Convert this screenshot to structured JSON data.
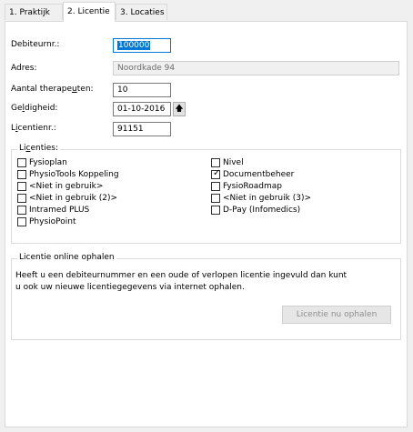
{
  "tabs": [
    {
      "label": "1. Praktijk"
    },
    {
      "label": "2. Licentie"
    },
    {
      "label": "3. Locaties"
    }
  ],
  "form": {
    "debiteurnr": {
      "label": "Debiteurnr.:",
      "value": "100000"
    },
    "adres": {
      "label": "Adres:",
      "value": "Noordkade 94"
    },
    "aantal": {
      "label_pre": "Aantal therape",
      "label_u": "u",
      "label_post": "ten:",
      "value": "10"
    },
    "geldigheid": {
      "label_pre": "Ge",
      "label_u": "l",
      "label_post": "digheid:",
      "value": "01-10-2016",
      "button_glyph": "🡅"
    },
    "licentienr": {
      "label_pre": "L",
      "label_u": "i",
      "label_post": "centienr.:",
      "value": "91151"
    }
  },
  "licenties": {
    "title_pre": "Li",
    "title_u": "c",
    "title_post": "enties:",
    "left": [
      {
        "label": "Fysioplan",
        "checked": false
      },
      {
        "label": "PhysioTools Koppeling",
        "checked": false
      },
      {
        "label": "<Niet in gebruik>",
        "checked": false
      },
      {
        "label": "<Niet in gebruik (2)>",
        "checked": false
      },
      {
        "label": "Intramed PLUS",
        "checked": false
      },
      {
        "label": "PhysioPoint",
        "checked": false
      }
    ],
    "right": [
      {
        "label": "Nivel",
        "checked": false
      },
      {
        "label": "Documentbeheer",
        "checked": true
      },
      {
        "label": "FysioRoadmap",
        "checked": false
      },
      {
        "label": "<Niet in gebruik (3)>",
        "checked": false
      },
      {
        "label": "D-Pay (Infomedics)",
        "checked": false
      }
    ]
  },
  "online": {
    "title": "Licentie online ophalen",
    "text_line1": "Heeft u een debiteurnummer en een oude of verlopen licentie ingevuld dan kunt",
    "text_line2": "u ook uw nieuwe licentiegegevens via internet ophalen.",
    "button": "Licentie nu ophalen"
  }
}
